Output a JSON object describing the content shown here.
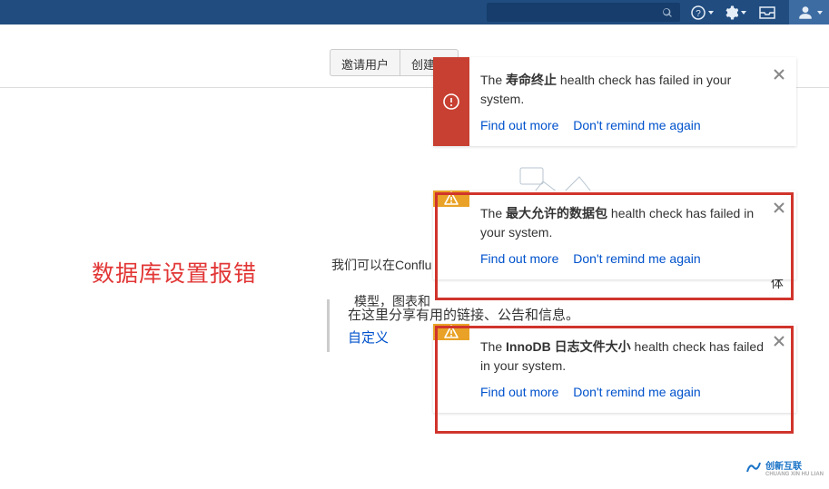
{
  "topbar": {
    "search_placeholder": ""
  },
  "toolbar": {
    "invite_label": "邀请用户",
    "create_label": "创建…"
  },
  "annotation": {
    "title": "数据库设置报错"
  },
  "body": {
    "line1": "我们可以在Conflu",
    "line1_suffix": "体",
    "line2": "模型，图表和"
  },
  "share": {
    "line1": "在这里分享有用的链接、公告和信息。",
    "customize": "自定义"
  },
  "notifications": [
    {
      "pre": "The ",
      "bold": "寿命终止",
      "post": " health check has failed in your system.",
      "find": "Find out more",
      "dont": "Don't remind me again"
    },
    {
      "pre": "The ",
      "bold": "最大允许的数据包",
      "post": " health check has failed in your system.",
      "find": "Find out more",
      "dont": "Don't remind me again"
    },
    {
      "pre": "The ",
      "bold": "InnoDB 日志文件大小",
      "post": " health check has failed in your system.",
      "find": "Find out more",
      "dont": "Don't remind me again"
    }
  ],
  "watermark": {
    "main": "创新互联",
    "sub": "CHUANG XIN HU LIAN"
  }
}
